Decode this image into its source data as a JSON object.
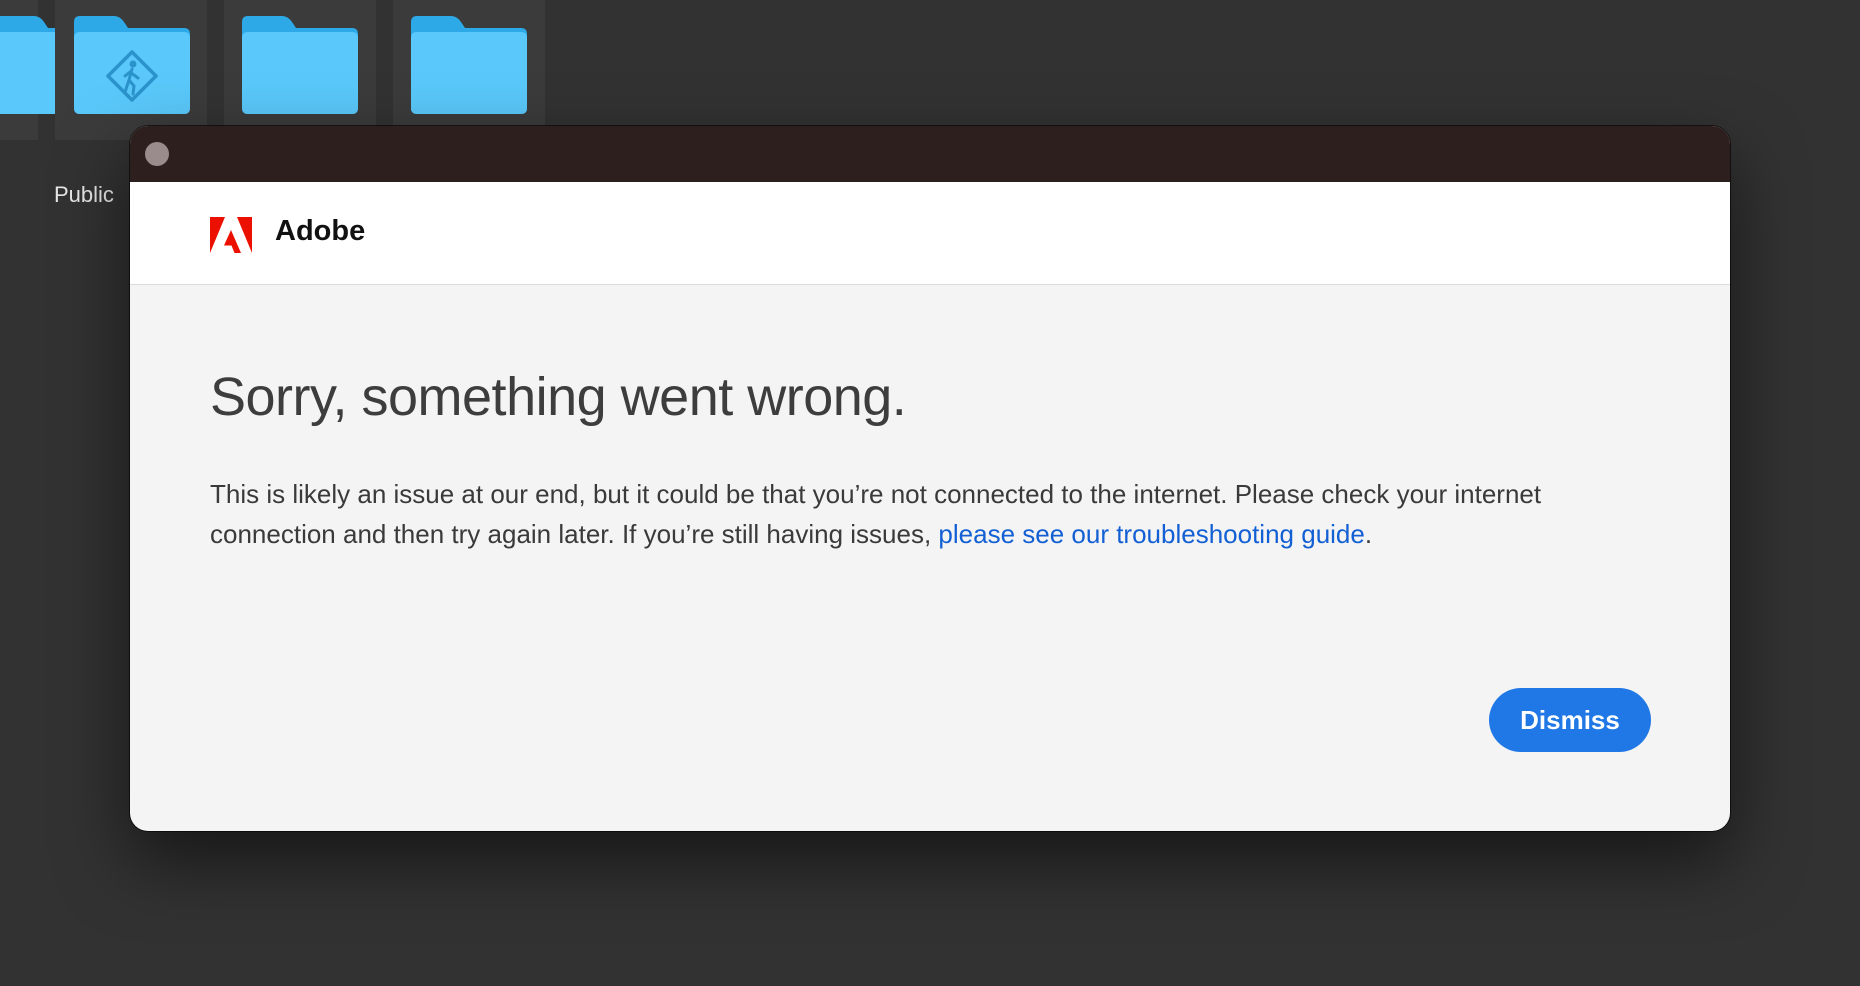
{
  "desktop": {
    "folders": [
      {
        "name": "",
        "icon": "folder-icon"
      },
      {
        "name": "Public",
        "icon": "public-folder-icon"
      },
      {
        "name": "",
        "icon": "folder-icon"
      },
      {
        "name": "",
        "icon": "folder-icon"
      }
    ]
  },
  "dialog": {
    "brand_name": "Adobe",
    "headline": "Sorry, something went wrong.",
    "message_part1": "This is likely an issue at our end, but it could be that you’re not connected to the internet. Please check your internet connection and then try again later. If you’re still having issues, ",
    "link_text": "please see our troubleshooting guide",
    "message_end": ".",
    "dismiss_label": "Dismiss"
  },
  "colors": {
    "titlebar": "#2e1f1f",
    "accent": "#1f78e6",
    "link": "#1360d4",
    "adobe_red": "#eb1000",
    "folder_blue": "#5ac8fa"
  }
}
